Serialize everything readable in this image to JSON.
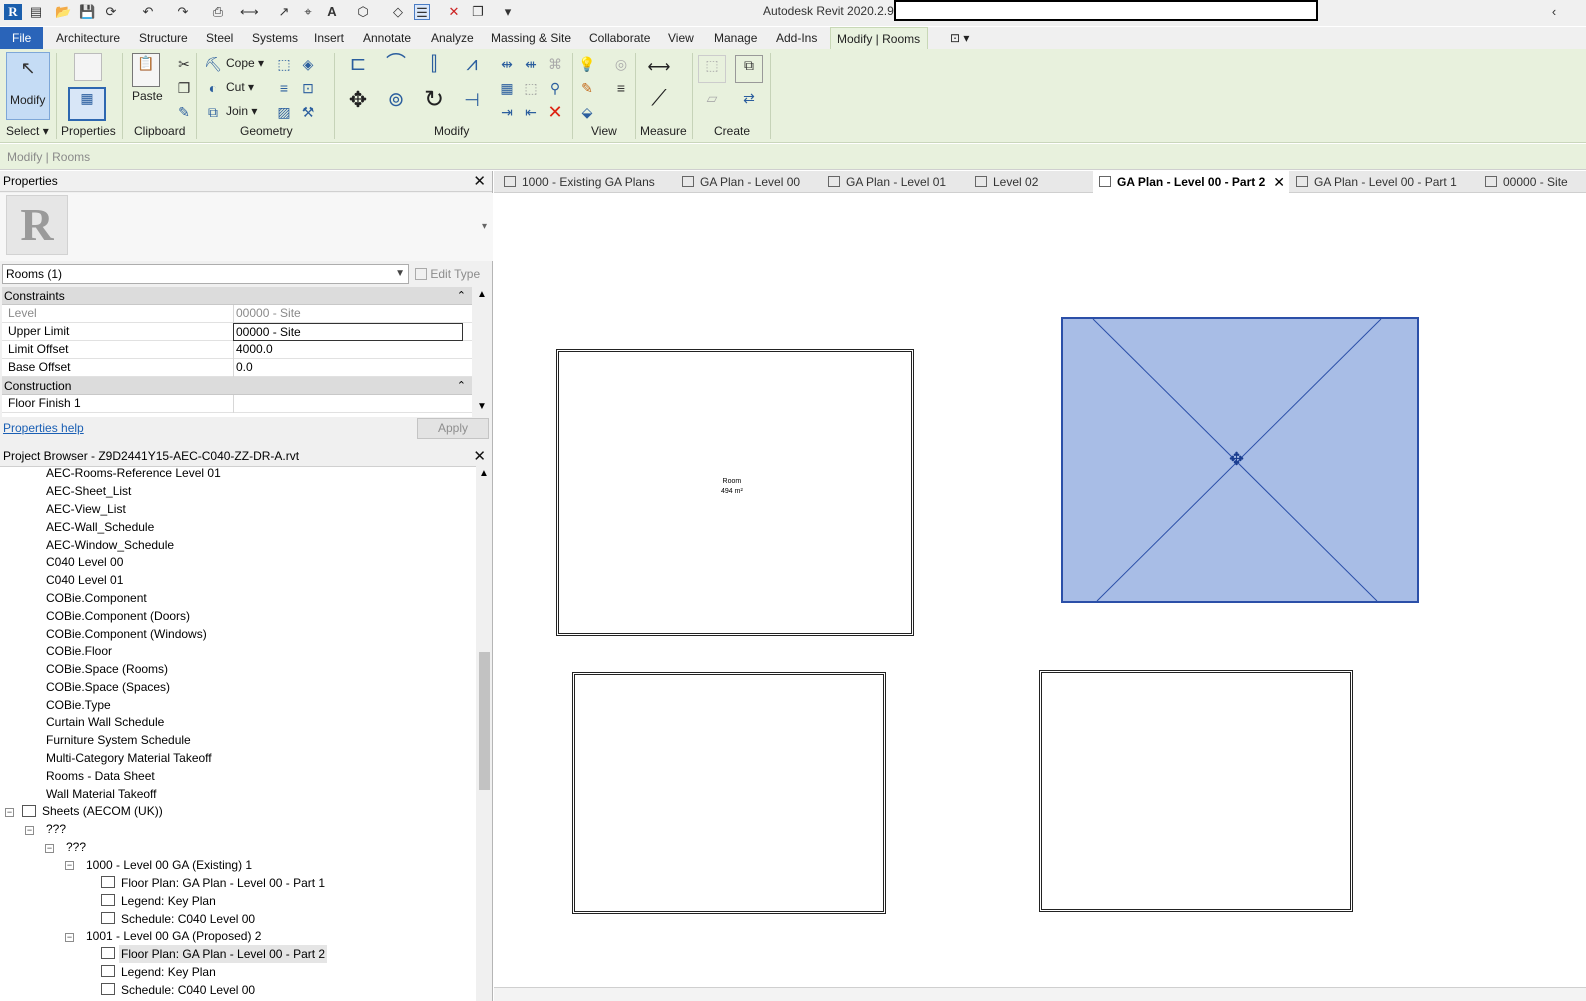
{
  "app": {
    "title": "Autodesk Revit 2020.2.9"
  },
  "ribbon_tabs": [
    "File",
    "Architecture",
    "Structure",
    "Steel",
    "Systems",
    "Insert",
    "Annotate",
    "Analyze",
    "Massing & Site",
    "Collaborate",
    "View",
    "Manage",
    "Add-Ins",
    "Modify | Rooms"
  ],
  "ribbon": {
    "modify_label": "Modify",
    "select_label": "Select",
    "properties_label": "Properties",
    "paste_label": "Paste",
    "clipboard_label": "Clipboard",
    "cope_label": "Cope",
    "cut_label": "Cut",
    "join_label": "Join",
    "geometry_label": "Geometry",
    "modify_panel_label": "Modify",
    "view_label": "View",
    "measure_label": "Measure",
    "create_label": "Create"
  },
  "options_bar": {
    "context": "Modify | Rooms"
  },
  "properties": {
    "title": "Properties",
    "type_selector": "Rooms (1)",
    "edit_type": "Edit Type",
    "help": "Properties help",
    "apply": "Apply",
    "groups": [
      {
        "name": "Constraints",
        "rows": [
          {
            "key": "Level",
            "value": "00000 - Site"
          },
          {
            "key": "Upper Limit",
            "value": "00000 - Site"
          },
          {
            "key": "Limit Offset",
            "value": "4000.0"
          },
          {
            "key": "Base Offset",
            "value": "0.0"
          }
        ]
      },
      {
        "name": "Construction",
        "rows": [
          {
            "key": "Floor Finish 1",
            "value": ""
          }
        ]
      }
    ]
  },
  "browser": {
    "title": "Project Browser - Z9D2441Y15-AEC-C040-ZZ-DR-A.rvt",
    "schedules": [
      "AEC-Rooms-Reference Level 01",
      "AEC-Sheet_List",
      "AEC-View_List",
      "AEC-Wall_Schedule",
      "AEC-Window_Schedule",
      "C040 Level 00",
      "C040 Level 01",
      "COBie.Component",
      "COBie.Component (Doors)",
      "COBie.Component (Windows)",
      "COBie.Floor",
      "COBie.Space (Rooms)",
      "COBie.Space (Spaces)",
      "COBie.Type",
      "Curtain Wall Schedule",
      "Furniture System Schedule",
      "Multi-Category Material Takeoff",
      "Rooms - Data Sheet",
      "Wall Material Takeoff"
    ],
    "sheets_root": "Sheets (AECOM (UK))",
    "q1": "???",
    "q2": "???",
    "sheet1": "1000 - Level 00 GA (Existing) 1",
    "sheet1_items": [
      "Floor Plan: GA Plan - Level 00 - Part 1",
      "Legend: Key Plan",
      "Schedule: C040 Level 00"
    ],
    "sheet2": "1001 - Level 00 GA (Proposed) 2",
    "sheet2_items": [
      "Floor Plan: GA Plan - Level 00 - Part 2",
      "Legend: Key Plan",
      "Schedule: C040 Level 00"
    ]
  },
  "view_tabs": [
    "1000 - Existing GA Plans",
    "GA Plan - Level 00",
    "GA Plan - Level 01",
    "Level 02",
    "GA Plan - Level 00 - Part 2",
    "GA Plan - Level 00 - Part 1",
    "00000 - Site"
  ],
  "canvas": {
    "room_label": "Room",
    "room_area": "494 m²"
  }
}
